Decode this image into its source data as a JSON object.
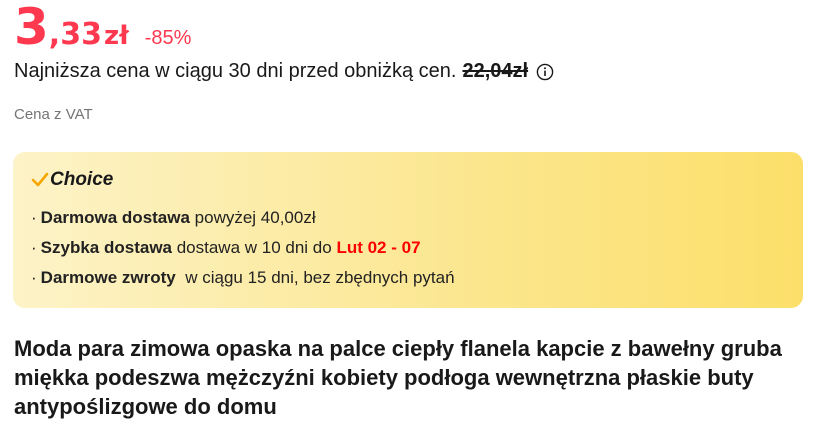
{
  "price": {
    "integer": "3",
    "fraction": ",33",
    "currency": "zł",
    "discount": "-85%"
  },
  "lowest_price": {
    "label": "Najniższa cena w ciągu 30 dni przed obniżką cen.",
    "old_price": "22,04zł"
  },
  "vat_label": "Cena z VAT",
  "choice": {
    "title": "Choice",
    "accent_color": "#f7a600",
    "benefits": [
      {
        "bold": "Darmowa dostawa",
        "text": " powyżej 40,00zł",
        "highlight": ""
      },
      {
        "bold": "Szybka dostawa",
        "text": " dostawa w 10 dni do ",
        "highlight": "Lut 02 - 07"
      },
      {
        "bold": "Darmowe zwroty",
        "text": "  w ciągu 15 dni, bez zbędnych pytań",
        "highlight": ""
      }
    ]
  },
  "product_title": "Moda para zimowa opaska na palce ciepły flanela kapcie z bawełny gruba miękka podeszwa mężczyźni kobiety podłoga wewnętrzna płaskie buty antypoślizgowe do domu",
  "colors": {
    "price_red": "#fd384f",
    "highlight_red": "#fd0000"
  }
}
